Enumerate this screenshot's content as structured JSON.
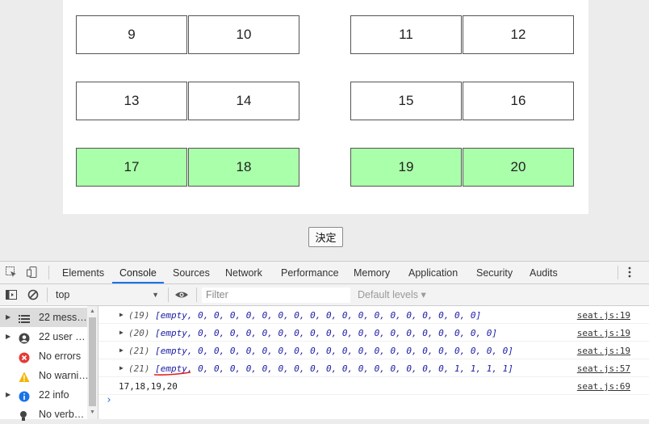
{
  "seats": [
    {
      "label": "9",
      "selected": false
    },
    {
      "label": "10",
      "selected": false
    },
    {
      "label": "11",
      "selected": false
    },
    {
      "label": "12",
      "selected": false
    },
    {
      "label": "13",
      "selected": false
    },
    {
      "label": "14",
      "selected": false
    },
    {
      "label": "15",
      "selected": false
    },
    {
      "label": "16",
      "selected": false
    },
    {
      "label": "17",
      "selected": true
    },
    {
      "label": "18",
      "selected": true
    },
    {
      "label": "19",
      "selected": true
    },
    {
      "label": "20",
      "selected": true
    }
  ],
  "colors": {
    "selected": "#aaffaa",
    "tab_accent": "#1a73e8",
    "console_text": "#1a1aa6"
  },
  "decide_label": "決定",
  "devtools": {
    "tabs": [
      "Elements",
      "Console",
      "Sources",
      "Network",
      "Performance",
      "Memory",
      "Application",
      "Security",
      "Audits"
    ],
    "active_tab": "Console",
    "context": "top",
    "filter_placeholder": "Filter",
    "levels": "Default levels ▾",
    "sidebar": [
      {
        "label": "22 mess…",
        "icon": "list-icon",
        "active": true
      },
      {
        "label": "22 user …",
        "icon": "user-icon",
        "active": false
      },
      {
        "label": "No errors",
        "icon": "error-icon",
        "active": false
      },
      {
        "label": "No warni…",
        "icon": "warning-icon",
        "active": false
      },
      {
        "label": "22 info",
        "icon": "info-icon",
        "active": false
      },
      {
        "label": "No verb…",
        "icon": "verbose-icon",
        "active": false
      }
    ],
    "console": [
      {
        "prefix": "(19) ",
        "text": "[empty, 0, 0, 0, 0, 0, 0, 0, 0, 0, 0, 0, 0, 0, 0, 0, 0, 0, 0]",
        "source": "seat.js:19",
        "expandable": true
      },
      {
        "prefix": "(20) ",
        "text": "[empty, 0, 0, 0, 0, 0, 0, 0, 0, 0, 0, 0, 0, 0, 0, 0, 0, 0, 0, 0]",
        "source": "seat.js:19",
        "expandable": true
      },
      {
        "prefix": "(21) ",
        "text": "[empty, 0, 0, 0, 0, 0, 0, 0, 0, 0, 0, 0, 0, 0, 0, 0, 0, 0, 0, 0, 0]",
        "source": "seat.js:19",
        "expandable": true
      },
      {
        "prefix": "(21) ",
        "text": "[empty, 0, 0, 0, 0, 0, 0, 0, 0, 0, 0, 0, 0, 0, 0, 0, 0, 1, 1, 1, 1]",
        "source": "seat.js:57",
        "expandable": true
      },
      {
        "prefix": "",
        "text": "17,18,19,20",
        "source": "seat.js:69",
        "expandable": false
      }
    ]
  }
}
